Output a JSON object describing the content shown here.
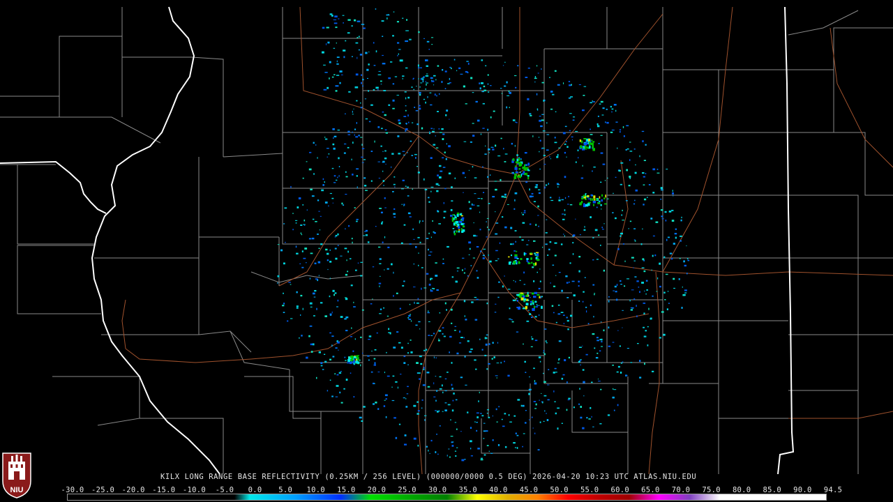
{
  "product": {
    "caption": "KILX LONG RANGE BASE REFLECTIVITY (0.25KM / 256 LEVEL) (000000/0000 0.5 DEG) 2026-04-20 10:23 UTC  ATLAS.NIU.EDU",
    "logo_text": "NIU"
  },
  "color_scale": {
    "labels": [
      "-30.0",
      "-25.0",
      "-20.0",
      "-15.0",
      "-10.0",
      "-5.0",
      "0.0",
      "5.0",
      "10.0",
      "15.0",
      "20.0",
      "25.0",
      "30.0",
      "35.0",
      "40.0",
      "45.0",
      "50.0",
      "55.0",
      "60.0",
      "65.0",
      "70.0",
      "75.0",
      "80.0",
      "85.0",
      "90.0",
      "94.5"
    ],
    "colors": [
      "#000000",
      "#000000",
      "#000000",
      "#000000",
      "#000000",
      "#000000",
      "#00e0e0",
      "#00a0f0",
      "#0050f0",
      "#0000d0",
      "#00e000",
      "#00b000",
      "#008000",
      "#ffff00",
      "#e0c000",
      "#ff9000",
      "#ff0000",
      "#d00000",
      "#b00000",
      "#ff00ff",
      "#9050d0",
      "#ffffff",
      "#ffffff",
      "#ffffff",
      "#ffffff",
      "#ffffff"
    ]
  },
  "map_colors": {
    "background": "#000000",
    "county_lines": "#8a8a8a",
    "state_lines": "#ffffff",
    "roads": "#a0522d"
  }
}
